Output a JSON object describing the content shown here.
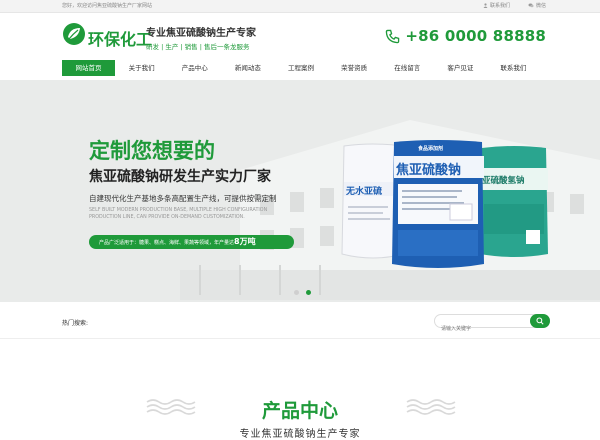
{
  "topbar": {
    "welcome": "您好，欢迎访问焦亚硫酸钠生产厂家网站",
    "contact_label": "联系我们",
    "wechat_label": "微信"
  },
  "header": {
    "logo_text": "环保化工",
    "slogan_main": "专业焦亚硫酸钠生产专家",
    "slogan_sub": "研发 | 生产 | 销售 | 售后一条龙服务",
    "phone": "+86 0000 88888"
  },
  "nav": {
    "items": [
      {
        "label": "网站首页",
        "active": true
      },
      {
        "label": "关于我们"
      },
      {
        "label": "产品中心"
      },
      {
        "label": "新闻动态"
      },
      {
        "label": "工程案例"
      },
      {
        "label": "荣誉资质"
      },
      {
        "label": "在线留言"
      },
      {
        "label": "客户见证"
      },
      {
        "label": "联系我们"
      }
    ]
  },
  "banner": {
    "headline": "定制您想要的",
    "subline": "焦亚硫酸钠研发生产实力厂家",
    "desc": "自建现代化生产基地多条高配置生产线，可提供按需定制",
    "en_text": "SELF BUILT MODERN PRODUCTION BASE, MULTIPLE HIGH CONFIGURATION PRODUCTION LINE, CAN PROVIDE ON-DEMAND CUSTOMIZATION.",
    "pill_text": "产品广泛适用于：糖果、糕点、海鲜、果蔬等领域，年产量达",
    "pill_value": "8万吨",
    "bags": {
      "bag1_label": "无水亚硫",
      "bag2_label": "焦亚硫酸钠",
      "bag2_top": "食品添加剂",
      "bag3_label": "亚硫酸氢钠"
    },
    "slides": 2,
    "active_slide": 2
  },
  "search": {
    "hot_label": "热门搜索:",
    "placeholder": "请输入关键字"
  },
  "products": {
    "title": "产品中心",
    "subtitle": "专业焦亚硫酸钠生产专家"
  },
  "colors": {
    "brand_green": "#1f9a3a",
    "bag_blue": "#1e5fb3",
    "bag_teal": "#2aa58f"
  }
}
